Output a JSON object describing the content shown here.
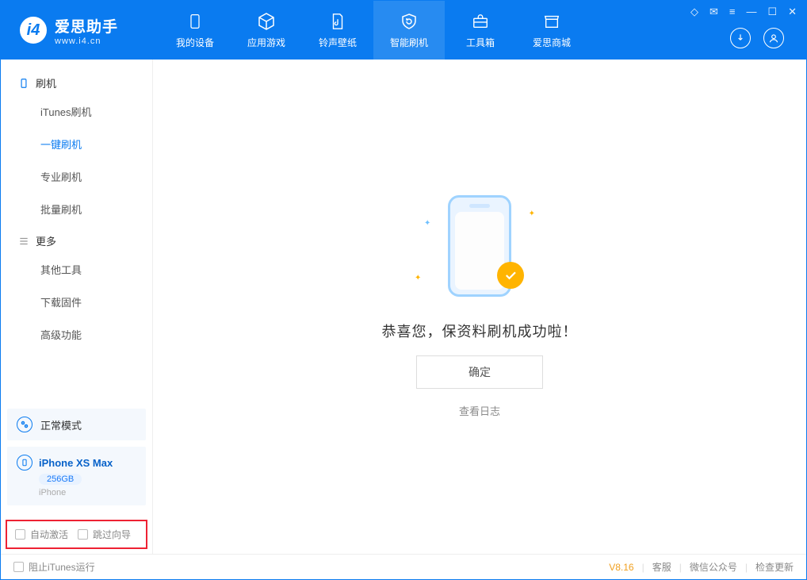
{
  "app": {
    "name_cn": "爱思助手",
    "domain": "www.i4.cn"
  },
  "nav": {
    "items": [
      {
        "label": "我的设备"
      },
      {
        "label": "应用游戏"
      },
      {
        "label": "铃声壁纸"
      },
      {
        "label": "智能刷机"
      },
      {
        "label": "工具箱"
      },
      {
        "label": "爱思商城"
      }
    ]
  },
  "sidebar": {
    "group_flash": "刷机",
    "flash_items": [
      {
        "label": "iTunes刷机"
      },
      {
        "label": "一键刷机"
      },
      {
        "label": "专业刷机"
      },
      {
        "label": "批量刷机"
      }
    ],
    "group_more": "更多",
    "more_items": [
      {
        "label": "其他工具"
      },
      {
        "label": "下载固件"
      },
      {
        "label": "高级功能"
      }
    ],
    "mode": "正常模式",
    "device": {
      "name": "iPhone XS Max",
      "capacity": "256GB",
      "type": "iPhone"
    },
    "options": {
      "auto_activate": "自动激活",
      "skip_guide": "跳过向导"
    }
  },
  "main": {
    "success_message": "恭喜您，保资料刷机成功啦！",
    "ok_button": "确定",
    "view_log": "查看日志"
  },
  "statusbar": {
    "block_itunes": "阻止iTunes运行",
    "version": "V8.16",
    "support": "客服",
    "wechat": "微信公众号",
    "check_update": "检查更新"
  }
}
